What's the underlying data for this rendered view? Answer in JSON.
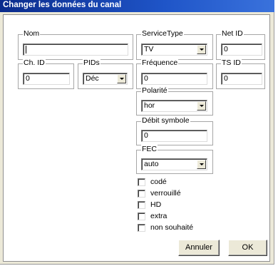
{
  "window": {
    "title": "Changer les données du canal"
  },
  "fields": {
    "nom": {
      "label": "Nom",
      "value": ""
    },
    "service_type": {
      "label": "ServiceType",
      "value": "TV"
    },
    "net_id": {
      "label": "Net ID",
      "value": "0"
    },
    "ch_id": {
      "label": "Ch. ID",
      "value": "0"
    },
    "pids": {
      "label": "PIDs",
      "value": "Déc"
    },
    "frequence": {
      "label": "Fréquence",
      "value": "0"
    },
    "ts_id": {
      "label": "TS ID",
      "value": "0"
    },
    "polarite": {
      "label": "Polarité",
      "value": "hor"
    },
    "debit_symbole": {
      "label": "Débit symbole",
      "value": "0"
    },
    "fec": {
      "label": "FEC",
      "value": "auto"
    }
  },
  "checkboxes": [
    {
      "label": "codé",
      "checked": false
    },
    {
      "label": "verrouillé",
      "checked": false
    },
    {
      "label": "HD",
      "checked": false
    },
    {
      "label": "extra",
      "checked": false
    },
    {
      "label": "non souhaité",
      "checked": false
    }
  ],
  "buttons": {
    "cancel": "Annuler",
    "ok": "OK"
  },
  "colors": {
    "titlebar_start": "#0a2b8c",
    "titlebar_end": "#3a72dc",
    "dialog_bg": "#ece9d8"
  }
}
